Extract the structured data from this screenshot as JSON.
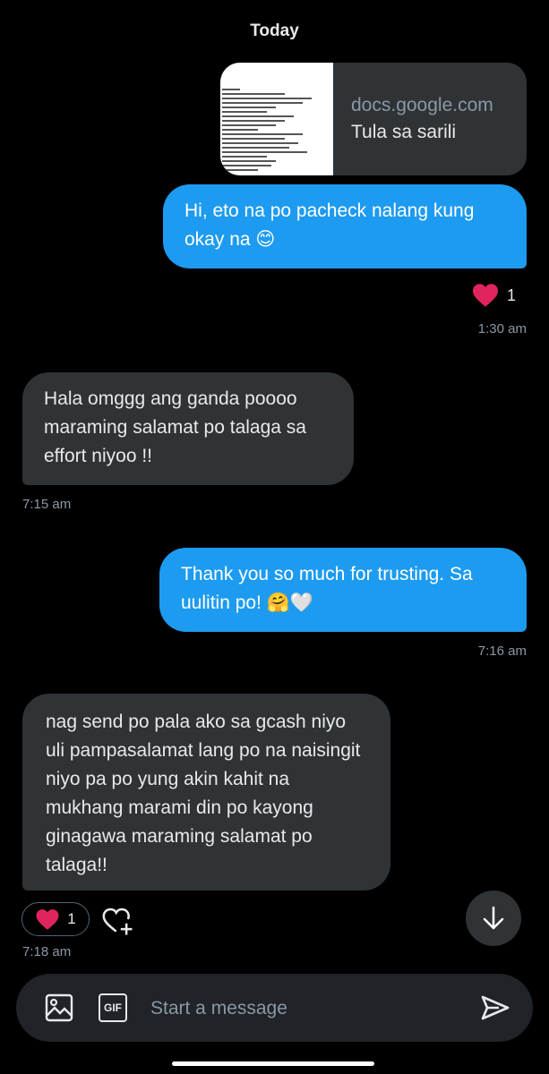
{
  "header": {
    "date": "Today"
  },
  "messages": [
    {
      "link_domain": "docs.google.com",
      "link_title": "Tula sa sarili"
    },
    {
      "text": "Hi, eto na po pacheck nalang kung okay na 😊",
      "reaction_count": "1",
      "time": "1:30 am"
    },
    {
      "text": "Hala omggg ang ganda poooo maraming salamat po talaga sa effort niyoo !!",
      "time": "7:15 am"
    },
    {
      "text": "Thank you so much for trusting. Sa uulitin po! 🤗🤍",
      "time": "7:16 am"
    },
    {
      "text": "nag send po pala ako sa gcash niyo uli pampasalamat lang po na naisingit niyo pa po yung akin kahit na mukhang marami din po kayong ginagawa maraming salamat po talaga!!",
      "reaction_count": "1",
      "time": "7:18 am"
    }
  ],
  "composer": {
    "placeholder": "Start a message",
    "gif_label": "GIF"
  },
  "icons": {
    "heart": "heart-icon",
    "add_reaction": "add-reaction-icon",
    "scroll_down": "arrow-down-icon",
    "image": "image-icon",
    "gif": "gif-icon",
    "send": "send-icon"
  },
  "colors": {
    "sent_bubble": "#1d9bf0",
    "received_bubble": "#2f3336",
    "heart": "#f91880"
  }
}
